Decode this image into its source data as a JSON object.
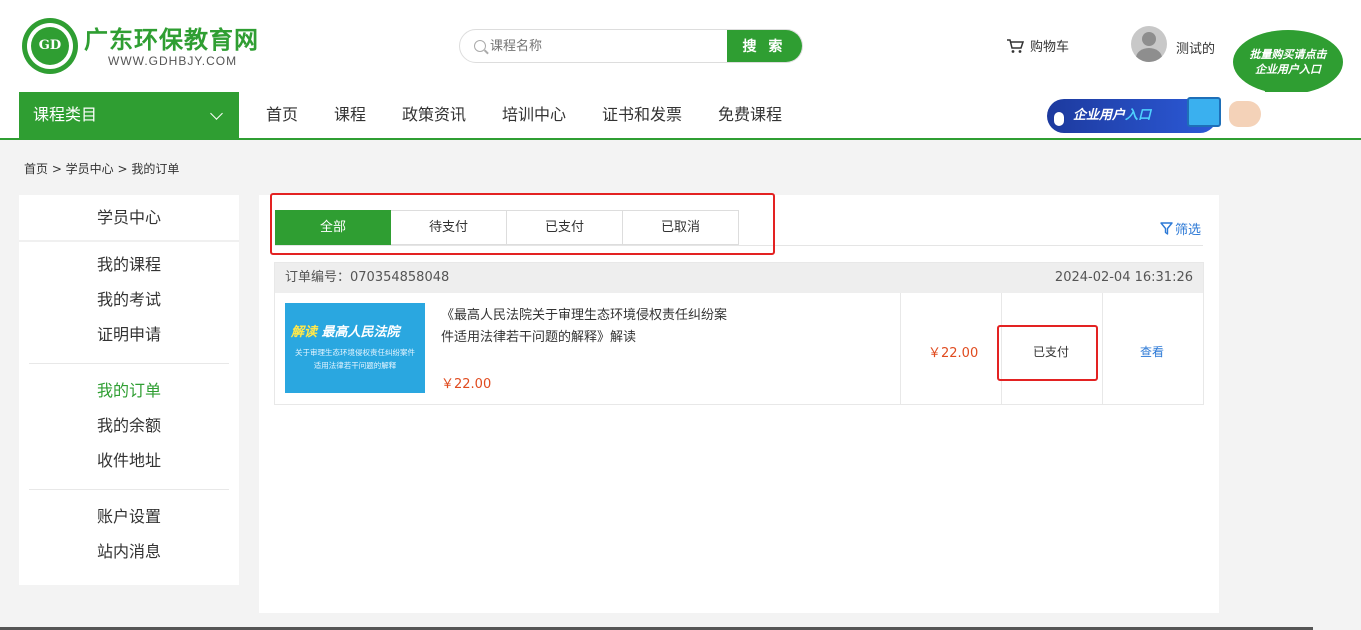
{
  "header": {
    "brand_title": "广东环保教育网",
    "brand_url": "WWW.GDHBJY.COM",
    "logo_text": "GD",
    "search": {
      "placeholder": "课程名称",
      "button": "搜 索"
    },
    "cart_label": "购物车",
    "username": "测试的",
    "promo_bubble": [
      "批量购买请点击",
      "企业用户入口"
    ]
  },
  "nav": {
    "category_label": "课程类目",
    "items": [
      "首页",
      "课程",
      "政策资讯",
      "培训中心",
      "证书和发票",
      "免费课程"
    ],
    "enterprise_entry": {
      "text": "企业用户",
      "highlight": "入口"
    }
  },
  "breadcrumb": "首页 > 学员中心 > 我的订单",
  "sidebar": {
    "title": "学员中心",
    "groups": [
      [
        "我的课程",
        "我的考试",
        "证明申请"
      ],
      [
        "我的订单",
        "我的余额",
        "收件地址"
      ],
      [
        "账户设置",
        "站内消息"
      ]
    ],
    "active": "我的订单"
  },
  "orders_panel": {
    "tabs": [
      "全部",
      "待支付",
      "已支付",
      "已取消"
    ],
    "active_tab": "全部",
    "filter_label": "筛选",
    "orders": [
      {
        "order_no_label": "订单编号：070354858048",
        "time": "2024-02-04 16:31:26",
        "thumbnail": {
          "title_prefix": "解读",
          "title_main": "最高人民法院",
          "sub1": "关于审理生态环境侵权责任纠纷案件",
          "sub2": "适用法律若干问题的解释"
        },
        "title_line1": "《最高人民法院关于审理生态环境侵权责任纠纷案",
        "title_line2": "件适用法律若干问题的解释》解读",
        "item_price": "￥22.00",
        "total_price": "￥22.00",
        "status": "已支付",
        "action": "查看"
      }
    ]
  },
  "colors": {
    "brand_green": "#2f9e32",
    "price_red": "#e04b1f",
    "link_blue": "#2c79d6",
    "annotation_red": "#e32222"
  }
}
